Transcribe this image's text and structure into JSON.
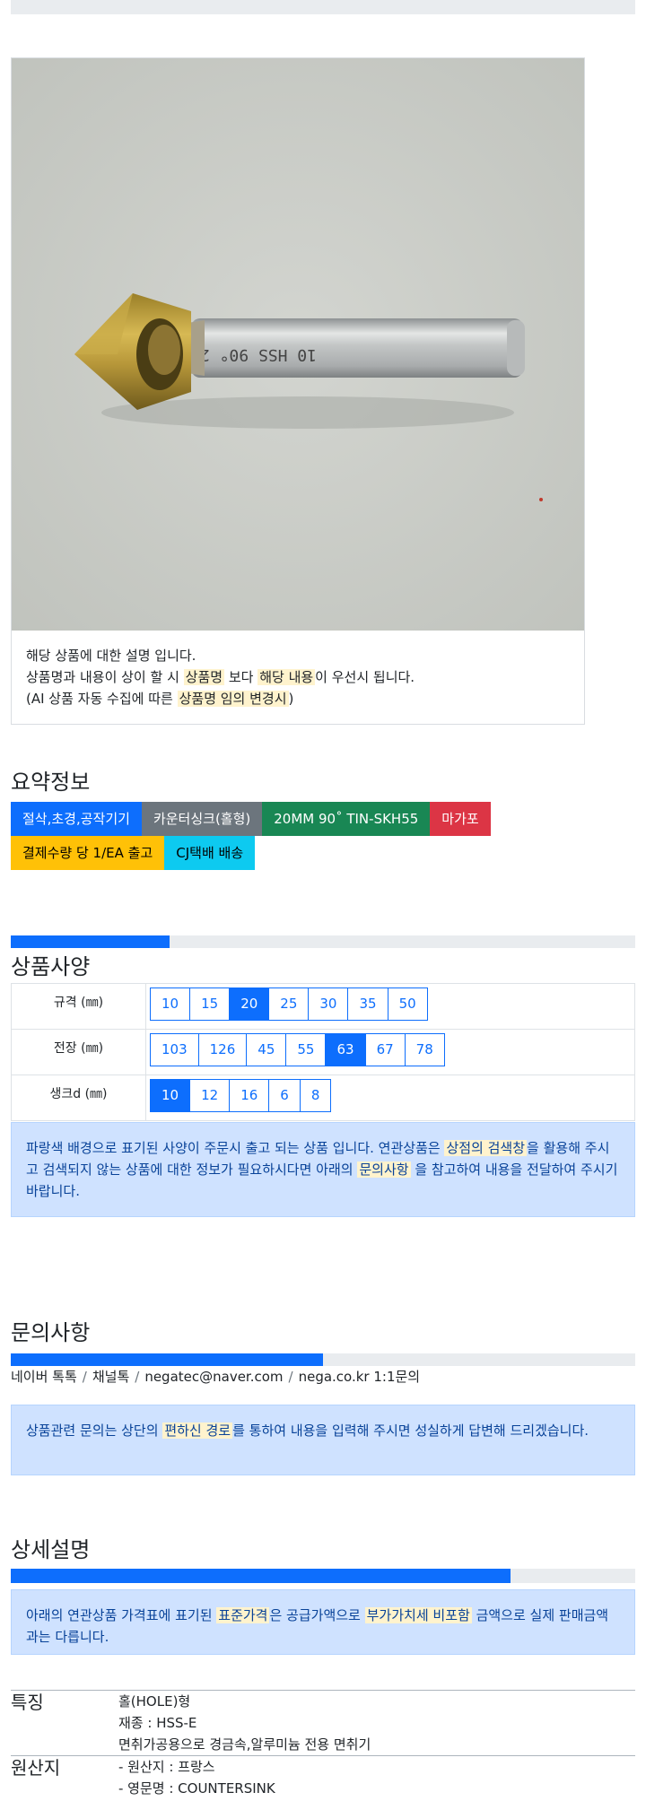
{
  "image_caption": {
    "line1": "해당 상품에 대한 설명 입니다.",
    "line2_a": "상품명과 내용이 상이 할 시 ",
    "line2_hl1": "상품명",
    "line2_b": " 보다 ",
    "line2_hl2": "해당 내용",
    "line2_c": "이 우선시 됩니다.",
    "line3_a": "(AI 상품 자동 수집에 따른 ",
    "line3_hl": "상품명 임의 변경시",
    "line3_b": ")"
  },
  "summary": {
    "title": "요약정보",
    "tags_row1": [
      {
        "label": "절삭,초경,공작기기",
        "color": "#0d6efd"
      },
      {
        "label": "카운터싱크(홀형)",
        "color": "#6c757d"
      },
      {
        "label": "20MM 90˚ TIN-SKH55",
        "color": "#198754"
      },
      {
        "label": "마가포",
        "color": "#dc3545"
      }
    ],
    "tags_row2": [
      {
        "label": "결제수량 당 1/EA 출고",
        "color": "#ffc107"
      },
      {
        "label": "CJ택배 배송",
        "color": "#0dcaf0"
      }
    ]
  },
  "spec": {
    "title": "상품사양",
    "progress": 0.255,
    "rows": [
      {
        "label": "규격 (㎜)",
        "options": [
          "10",
          "15",
          "20",
          "25",
          "30",
          "35",
          "50"
        ],
        "selected": "20"
      },
      {
        "label": "전장 (㎜)",
        "options": [
          "103",
          "126",
          "45",
          "55",
          "63",
          "67",
          "78"
        ],
        "selected": "63"
      },
      {
        "label": "생크d (㎜)",
        "options": [
          "10",
          "12",
          "16",
          "6",
          "8"
        ],
        "selected": "10"
      }
    ],
    "notice_a": "파랑색 배경으로 표기된 사양이 주문시 출고 되는 상품 입니다. 연관상품은 ",
    "notice_hl1": "상점의 검색창",
    "notice_b": "을 활용해 주시고 검색되지 않는 상품에 대한 정보가 필요하시다면 아래의 ",
    "notice_hl2": "문의사항",
    "notice_c": " 을 참고하여 내용을 전달하여 주시기 바랍니다."
  },
  "inquiry": {
    "title": "문의사항",
    "progress": 0.5,
    "channels": [
      "네이버 톡톡",
      "채널톡",
      "negatec@naver.com",
      "nega.co.kr 1:1문의"
    ],
    "separator": "/",
    "notice_a": "상품관련 문의는 상단의 ",
    "notice_hl": "편하신 경로",
    "notice_b": "를 통하여 내용을 입력해 주시면 성실하게 답변해 드리겠습니다."
  },
  "detail": {
    "title": "상세설명",
    "progress": 0.8,
    "notice_a": "아래의 연관상품 가격표에 표기된 ",
    "notice_hl1": "표준가격",
    "notice_b": "은 공급가액으로 ",
    "notice_hl2": "부가가치세 비포함",
    "notice_c": " 금액으로 실제 판매금액과는 다릅니다.",
    "rows": [
      {
        "key": "특징",
        "values": [
          "홀(HOLE)형",
          "재종 : HSS-E",
          "면취가공용으로 경금속,알루미늄 전용 면취기"
        ]
      },
      {
        "key": "원산지",
        "values": [
          "- 원산지 : 프랑스",
          "- 영문명 : COUNTERSINK"
        ]
      }
    ]
  }
}
